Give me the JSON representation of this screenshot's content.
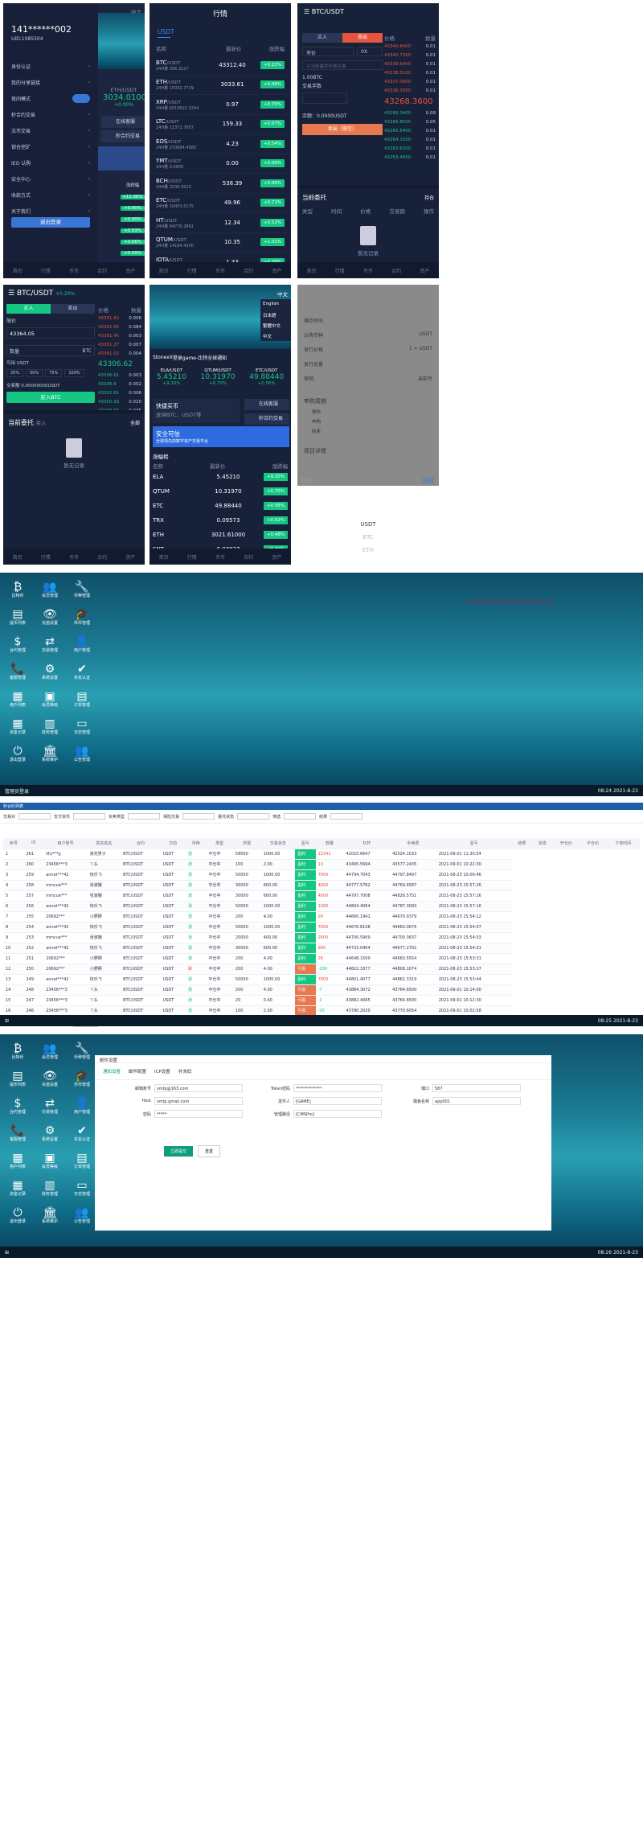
{
  "p1": {
    "time": "中文",
    "user": "141******002",
    "uid": "UID:1085504",
    "menu": [
      "身份认证",
      "我的分享链接",
      "夜间模式",
      "秒合约交易",
      "法币交易",
      "锁仓挖矿",
      "IEO 认购",
      "安全中心",
      "收款方式",
      "关于我们"
    ],
    "logout": "退出登录",
    "right_pair": "ETH/USDT",
    "right_price": "3034.01000",
    "right_change": "+0.00%",
    "chips": [
      "在线客服",
      "秒合约交易"
    ],
    "change_col": [
      "涨跌幅",
      "+11.06%",
      "+0.00%",
      "+0.00%",
      "+0.03%",
      "+0.06%",
      "+0.09%"
    ]
  },
  "p2": {
    "title": "行情",
    "tab": "USDT",
    "head": [
      "名称",
      "最新价",
      "涨跌幅"
    ],
    "rows": [
      {
        "s": "BTC",
        "v": "24H量 396.3127",
        "p": "43312.40",
        "c": "+0.22%"
      },
      {
        "s": "ETH",
        "v": "24H量 15032.7729",
        "p": "3033.61",
        "c": "+0.08%"
      },
      {
        "s": "XRP",
        "v": "24H量 6013622.2294",
        "p": "0.97",
        "c": "+0.70%"
      },
      {
        "s": "LTC",
        "v": "24H量 11372.7857",
        "p": "159.33",
        "c": "+0.07%"
      },
      {
        "s": "EOS",
        "v": "24H量 270684.4585",
        "p": "4.23",
        "c": "+0.54%"
      },
      {
        "s": "YMT",
        "v": "24H量 0.0000",
        "p": "0.00",
        "c": "+0.00%"
      },
      {
        "s": "BCH",
        "v": "24H量 2536.9510",
        "p": "538.39",
        "c": "+0.06%"
      },
      {
        "s": "ETC",
        "v": "24H量 10453.5175",
        "p": "49.96",
        "c": "+0.71%"
      },
      {
        "s": "HT",
        "v": "24H量 84776.2861",
        "p": "12.34",
        "c": "+0.52%"
      },
      {
        "s": "QTUM",
        "v": "24H量 14194.4300",
        "p": "10.35",
        "c": "+1.01%"
      },
      {
        "s": "IOTA",
        "v": "24H量 63076.4074",
        "p": "1.33",
        "c": "+0.29%"
      }
    ],
    "quote": "/USDT",
    "nav": [
      "首页",
      "行情",
      "币币",
      "合约",
      "资产"
    ]
  },
  "p3": {
    "pair": "BTC/USDT",
    "tabs": [
      "买入",
      "卖出"
    ],
    "type": "市价",
    "lev": "0X",
    "amount_ph": "以当前最优价格交易",
    "label1": "1.00BTC",
    "label2": "交易手数",
    "balance": "余额：0.0000USDT",
    "sell_btn": "卖出（做空）",
    "price_head": [
      "价格",
      "数量"
    ],
    "asks": [
      [
        "43340.8400",
        "0.01"
      ],
      [
        "43340.7300",
        "0.01"
      ],
      [
        "43339.6400",
        "0.01"
      ],
      [
        "43338.5100",
        "0.01"
      ],
      [
        "43337.0600",
        "0.01"
      ],
      [
        "43336.3300",
        "0.01"
      ]
    ],
    "mid": "43268.3600",
    "bids": [
      [
        "43268.3400",
        "0.09"
      ],
      [
        "43266.8000",
        "0.05"
      ],
      [
        "43265.6400",
        "0.01"
      ],
      [
        "43264.1500",
        "0.01"
      ],
      [
        "43263.6300",
        "0.01"
      ],
      [
        "43263.4600",
        "0.01"
      ]
    ],
    "orders": "当前委托",
    "hold": "持仓",
    "cols": [
      "类型",
      "时间",
      "价格",
      "交易额",
      "操作"
    ],
    "empty": "暂无记录"
  },
  "p4": {
    "pair": "BTC/USDT",
    "chg": "+0.20%",
    "tabs": [
      "买入",
      "卖出"
    ],
    "limit": "限价",
    "price": "43364.05",
    "amount": "数量",
    "unit": "BTC",
    "avail": "可用 USDT",
    "pcts": [
      "25%",
      "50%",
      "75%",
      "100%"
    ],
    "total": "交易额 0.00000000USDT",
    "buy": "买入BTC",
    "head": [
      "价格",
      "数量"
    ],
    "asks": [
      [
        "43361.62",
        "0.006"
      ],
      [
        "43361.55",
        "0.084"
      ],
      [
        "43361.45",
        "0.003"
      ],
      [
        "43361.27",
        "0.007"
      ],
      [
        "43361.02",
        "0.004"
      ]
    ],
    "mid": "43306.62",
    "bids": [
      [
        "43306.61",
        "0.003"
      ],
      [
        "43306.6",
        "0.002"
      ],
      [
        "43302.61",
        "0.006"
      ],
      [
        "43300.93",
        "0.020"
      ],
      [
        "43299.66",
        "0.035"
      ]
    ],
    "orders": "当前委托",
    "sub": "买入",
    "all": "全部",
    "empty": "暂无记录"
  },
  "p5": {
    "lang": "中文",
    "langs": [
      "English",
      "日本語",
      "繁體中文",
      "中文"
    ],
    "notice": "StonexX",
    "notice2": "登录game-比特全球通知",
    "tickers": [
      {
        "n": "ELA/USDT",
        "p": "5.45210",
        "c": "+9.20%"
      },
      {
        "n": "QTUM/USDT",
        "p": "10.31970",
        "c": "+0.70%"
      },
      {
        "n": "ETC/USDT",
        "p": "49.88440",
        "c": "+0.56%"
      }
    ],
    "quick": "快捷买币",
    "quick_sub": "支持BTC、USDT等",
    "svc": "在线客服",
    "sec": "秒合约交易",
    "banner": "安全可信",
    "banner_sub": "全球领先的数字资产交易平台",
    "rank": "涨幅榜",
    "head": [
      "名称",
      "最新价",
      "涨跌幅"
    ],
    "rows": [
      {
        "s": "ELA",
        "p": "5.45210",
        "c": "+9.20%"
      },
      {
        "s": "QTUM",
        "p": "10.31970",
        "c": "+0.70%"
      },
      {
        "s": "ETC",
        "p": "49.88440",
        "c": "+0.56%"
      },
      {
        "s": "TRX",
        "p": "0.09573",
        "c": "+0.52%"
      },
      {
        "s": "ETH",
        "p": "3021.61000",
        "c": "+0.48%"
      },
      {
        "s": "SNT",
        "p": "0.07837",
        "c": "+0.41%"
      }
    ]
  },
  "p6": {
    "fields": [
      [
        "储存时间",
        ""
      ],
      [
        "认购币种",
        "USDT"
      ],
      [
        "发行价格",
        "1 = USDT"
      ],
      [
        "发行总量",
        ""
      ],
      [
        "官网",
        "当前币"
      ]
    ],
    "period": "申购周期",
    "steps": [
      "预热",
      "申购",
      "结束"
    ],
    "detail": "项目详情",
    "cancel": "取消",
    "done": "完成",
    "picks": [
      "USDT",
      "BTC",
      "ETH"
    ]
  },
  "desk1": {
    "icons": [
      [
        "比特币",
        "₿"
      ],
      [
        "会员管理",
        "👥"
      ],
      [
        "币种管理",
        "🔧"
      ],
      [
        "提币列表",
        "▤"
      ],
      [
        "充值设置",
        "👁"
      ],
      [
        "币币管理",
        "🎓"
      ],
      [
        "合约管理",
        "$"
      ],
      [
        "交易管理",
        "⇄"
      ],
      [
        "用户管理",
        "👤"
      ],
      [
        "客服管理",
        "📞"
      ],
      [
        "系统设置",
        "⚙"
      ],
      [
        "实名认证",
        "✔"
      ],
      [
        "用户列表",
        "▦"
      ],
      [
        "会员等级",
        "▣"
      ],
      [
        "订单管理",
        "▤"
      ],
      [
        "资金记录",
        "▦"
      ],
      [
        "财务管理",
        "▥"
      ],
      [
        "日志管理",
        "▭"
      ],
      [
        "退出登录",
        "⏻"
      ],
      [
        "系统维护",
        "🏛"
      ],
      [
        "公告管理",
        "👥"
      ]
    ],
    "win": "管理员登录",
    "time": "08:24",
    "date": "2021-8-23"
  },
  "desk2": {
    "title": "秒合约列表",
    "filters": [
      "交易对",
      "支付货币",
      "买卖类型",
      "保险交易",
      "委托状态",
      "筛选",
      "结果"
    ],
    "head": [
      "序号",
      "ID",
      "用户账号",
      "真实姓名",
      "合约",
      "方向",
      "币种",
      "类型",
      "所需",
      "交易状态",
      "盈亏",
      "数量",
      "杠杆",
      "手续费",
      "盈亏",
      "结果",
      "状态",
      "开仓价",
      "平仓价",
      "下单时间"
    ],
    "rows": [
      [
        "1",
        "261",
        "lifu***g",
        "浪花男子",
        "BTC/USDT",
        "USDT",
        "涨",
        "平仓中",
        "58500",
        "1000.00",
        "盈利",
        "13342",
        "42010.6647",
        "42024.1033",
        "2021-09-01 11:30:54"
      ],
      [
        "2",
        "260",
        "23456***3",
        "丫头",
        "BTC/USDT",
        "USDT",
        "涨",
        "平仓中",
        "100",
        "2.00",
        "盈利",
        "13",
        "43495.5694",
        "43577.2435",
        "2021-09-01 10:22:30"
      ],
      [
        "3",
        "259",
        "annet***42",
        "快乐飞",
        "BTC/USDT",
        "USDT",
        "涨",
        "平仓中",
        "50000",
        "1000.00",
        "盈利",
        "7800",
        "44794.7043",
        "44797.8497",
        "2021-08-23 10:06:46"
      ],
      [
        "4",
        "258",
        "mmcue***",
        "张淑娥",
        "BTC/USDT",
        "USDT",
        "涨",
        "平仓中",
        "30000",
        "600.00",
        "盈利",
        "4800",
        "44777.5762",
        "44769.6587",
        "2021-08-23 15:57:26"
      ],
      [
        "5",
        "257",
        "mmcue***",
        "张淑娥",
        "BTC/USDT",
        "USDT",
        "涨",
        "平仓中",
        "30000",
        "600.00",
        "盈利",
        "4800",
        "44797.7008",
        "44826.5751",
        "2021-08-23 15:57:26"
      ],
      [
        "6",
        "256",
        "annet***42",
        "快乐飞",
        "BTC/USDT",
        "USDT",
        "涨",
        "平仓中",
        "50000",
        "1000.00",
        "盈利",
        "1000",
        "44804.4064",
        "44787.3093",
        "2021-08-23 15:57:16"
      ],
      [
        "7",
        "255",
        "20692***",
        "小野狮",
        "BTC/USDT",
        "USDT",
        "涨",
        "平仓中",
        "200",
        "4.00",
        "盈利",
        "26",
        "44660.1941",
        "44670.9379",
        "2021-08-23 15:54:12"
      ],
      [
        "8",
        "254",
        "annet***42",
        "快乐飞",
        "BTC/USDT",
        "USDT",
        "涨",
        "平仓中",
        "50000",
        "1000.00",
        "盈利",
        "7800",
        "44676.8108",
        "44660.0676",
        "2021-08-23 15:54:07"
      ],
      [
        "9",
        "253",
        "mmcue***",
        "张淑娥",
        "BTC/USDT",
        "USDT",
        "涨",
        "平仓中",
        "20000",
        "400.00",
        "盈利",
        "2600",
        "44700.5909",
        "44700.3637",
        "2021-08-23 15:54:03"
      ],
      [
        "10",
        "252",
        "annet***42",
        "快乐飞",
        "BTC/USDT",
        "USDT",
        "涨",
        "平仓中",
        "30000",
        "600.00",
        "盈利",
        "900",
        "44733.0404",
        "44677.2702",
        "2021-08-23 15:54:01"
      ],
      [
        "11",
        "251",
        "20692***",
        "小野狮",
        "BTC/USDT",
        "USDT",
        "涨",
        "平仓中",
        "200",
        "4.00",
        "盈利",
        "26",
        "44648.1509",
        "44660.5554",
        "2021-08-23 15:53:31"
      ],
      [
        "12",
        "250",
        "20692***",
        "小野狮",
        "BTC/USDT",
        "USDT",
        "跌",
        "平仓中",
        "200",
        "4.00",
        "亏损",
        "-200",
        "44822.3377",
        "44808.1074",
        "2021-08-23 15:53:37"
      ],
      [
        "13",
        "249",
        "annet***42",
        "快乐飞",
        "BTC/USDT",
        "USDT",
        "涨",
        "平仓中",
        "50000",
        "1000.00",
        "盈利",
        "7800",
        "44801.4077",
        "44862.3319",
        "2021-08-23 15:53:44"
      ],
      [
        "14",
        "248",
        "23456***3",
        "丫头",
        "BTC/USDT",
        "USDT",
        "涨",
        "平仓中",
        "200",
        "4.00",
        "亏损",
        "-7",
        "43884.3072",
        "43764.6500",
        "2021-09-01 10:14:00"
      ],
      [
        "15",
        "247",
        "23456***3",
        "丫头",
        "BTC/USDT",
        "USDT",
        "涨",
        "平仓中",
        "20",
        "0.40",
        "亏损",
        "-2",
        "43882.4065",
        "43764.6500",
        "2021-09-01 10:12:30"
      ],
      [
        "16",
        "246",
        "23456***3",
        "丫头",
        "BTC/USDT",
        "USDT",
        "涨",
        "平仓中",
        "100",
        "2.00",
        "亏损",
        "-20",
        "43790.2020",
        "43770.6054",
        "2021-09-01 10:02:58"
      ]
    ],
    "pages": [
      "1",
      "2",
      "3",
      "516"
    ],
    "total": "共 257 条",
    "per": "100 条/页",
    "time": "08:25",
    "date": "2021-8-23"
  },
  "desk3": {
    "title": "邮件设置",
    "tabs": [
      "通知设置",
      "邮件配置",
      "ICP设置",
      "补充码"
    ],
    "f": [
      [
        "邮箱账号",
        "smtp@163.com"
      ],
      [
        "Token密码",
        "*************"
      ],
      [
        "端口",
        "587"
      ],
      [
        "Host",
        "smtp.gmail.com"
      ],
      [
        "发件人",
        "[GAME]"
      ],
      [
        "模板名称",
        "app001"
      ],
      [
        "密码",
        "*****"
      ],
      [
        "管理路径",
        "[CMSPro]"
      ]
    ],
    "save": "立即提交",
    "reset": "重置",
    "time": "08:26",
    "date": "2021-8-23"
  }
}
